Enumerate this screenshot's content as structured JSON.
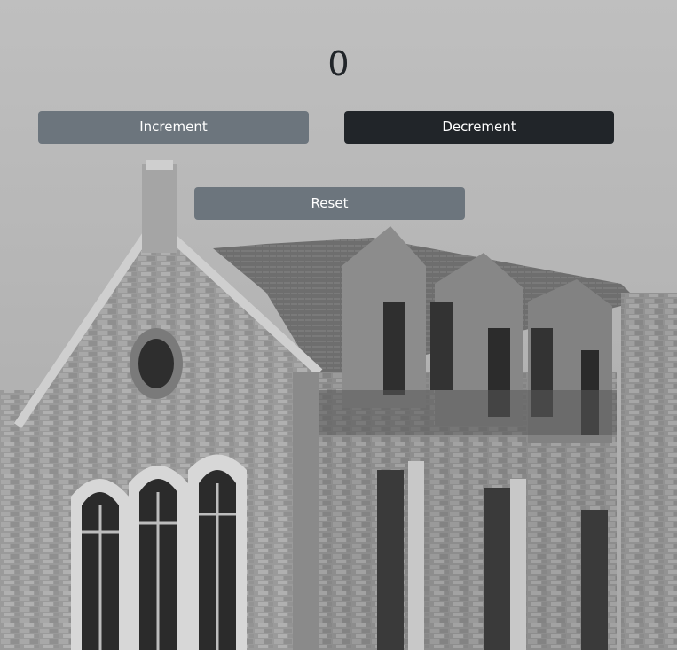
{
  "counter": {
    "value": "0"
  },
  "buttons": {
    "increment_label": "Increment",
    "decrement_label": "Decrement",
    "reset_label": "Reset"
  },
  "colors": {
    "secondary": "#6c757d",
    "dark": "#212529",
    "text": "#212529"
  },
  "background": {
    "icon": "old-stone-building-photo"
  }
}
